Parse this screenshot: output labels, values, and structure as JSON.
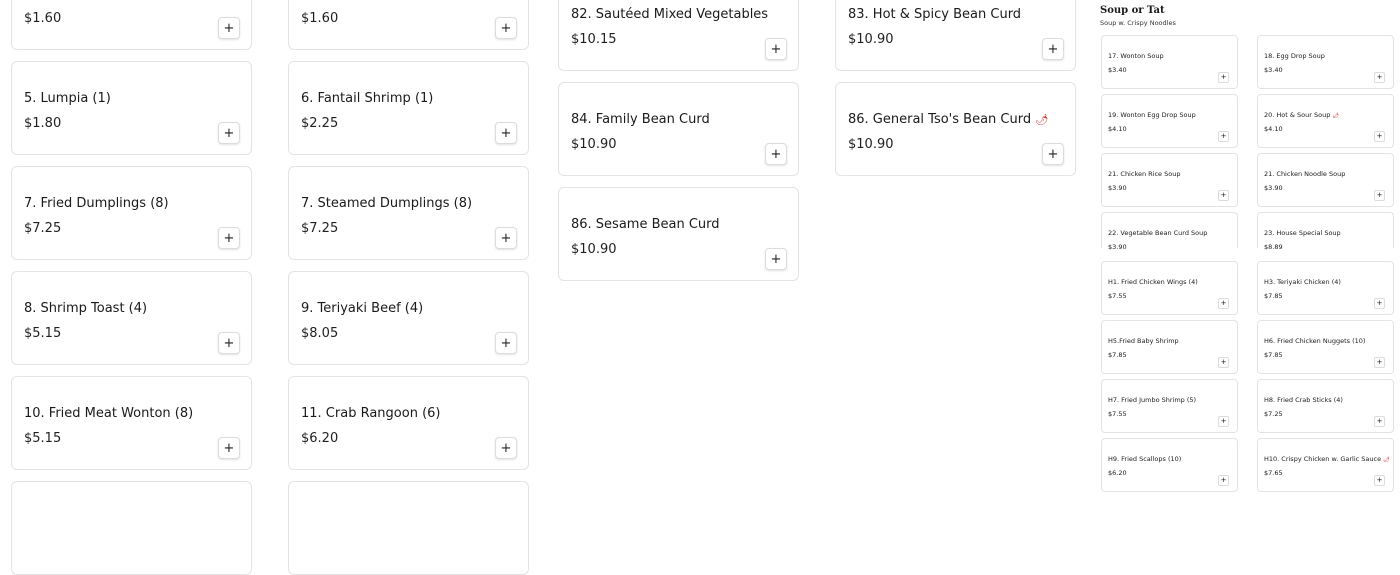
{
  "add_button_glyph": "+",
  "column1": [
    {
      "name": "",
      "price": "$1.60"
    },
    {
      "name": "5. Lumpia (1)",
      "price": "$1.80"
    },
    {
      "name": "7. Fried Dumplings (8)",
      "price": "$7.25"
    },
    {
      "name": "8. Shrimp Toast (4)",
      "price": "$5.15"
    },
    {
      "name": "10. Fried Meat Wonton (8)",
      "price": "$5.15"
    },
    {
      "name": "",
      "price": ""
    }
  ],
  "column2": [
    {
      "name": "",
      "price": "$1.60"
    },
    {
      "name": "6. Fantail Shrimp (1)",
      "price": "$2.25"
    },
    {
      "name": "7. Steamed Dumplings (8)",
      "price": "$7.25"
    },
    {
      "name": "9. Teriyaki Beef (4)",
      "price": "$8.05"
    },
    {
      "name": "11. Crab Rangoon (6)",
      "price": "$6.20"
    },
    {
      "name": "",
      "price": ""
    }
  ],
  "column3": [
    {
      "name": "82. Sautéed Mixed Vegetables",
      "price": "$10.15"
    },
    {
      "name": "84. Family Bean Curd",
      "price": "$10.90"
    },
    {
      "name": "86. Sesame Bean Curd",
      "price": "$10.90"
    }
  ],
  "column4": [
    {
      "name": "83. Hot & Spicy Bean Curd",
      "price": "$10.90",
      "spicy": false
    },
    {
      "name": "86. General Tso's Bean Curd",
      "price": "$10.90",
      "spicy": true
    }
  ],
  "side_section": {
    "title": "Soup or Tat",
    "subtitle": "Soup w. Crispy Noodles",
    "items": [
      {
        "name": "17. Wonton Soup",
        "price": "$3.40",
        "spicy": false
      },
      {
        "name": "18. Egg Drop Soup",
        "price": "$3.40",
        "spicy": false
      },
      {
        "name": "19. Wonton Egg Drop Soup",
        "price": "$4.10",
        "spicy": false
      },
      {
        "name": "20. Hot & Sour Soup",
        "price": "$4.10",
        "spicy": true
      },
      {
        "name": "21. Chicken Rice Soup",
        "price": "$3.90",
        "spicy": false
      },
      {
        "name": "21. Chicken Noodle Soup",
        "price": "$3.90",
        "spicy": false
      },
      {
        "name": "22. Vegetable Bean Curd Soup",
        "price": "$3.90",
        "spicy": false
      },
      {
        "name": "23. House Special Soup",
        "price": "$8.89",
        "spicy": false
      },
      {
        "name": "H1. Fried Chicken Wings (4)",
        "price": "$7.55",
        "spicy": false
      },
      {
        "name": "H3. Teriyaki Chicken (4)",
        "price": "$7.85",
        "spicy": false
      },
      {
        "name": "H5.Fried Baby Shrimp",
        "price": "$7.85",
        "spicy": false
      },
      {
        "name": "H6. Fried Chicken Nuggets (10)",
        "price": "$7.85",
        "spicy": false
      },
      {
        "name": "H7. Fried Jumbo Shrimp (5)",
        "price": "$7.55",
        "spicy": false
      },
      {
        "name": "H8. Fried Crab Sticks (4)",
        "price": "$7.25",
        "spicy": false
      },
      {
        "name": "H9. Fried Scallops (10)",
        "price": "$6.20",
        "spicy": false
      },
      {
        "name": "H10. Crispy Chicken w. Garlic Sauce",
        "price": "$7.65",
        "spicy": true
      }
    ]
  },
  "icons": {
    "add": "plus-icon",
    "spicy": "chili-pepper-icon"
  },
  "colors": {
    "border": "#e3e3e3",
    "spicy": "#d4281f",
    "text": "#1a1a1a"
  }
}
